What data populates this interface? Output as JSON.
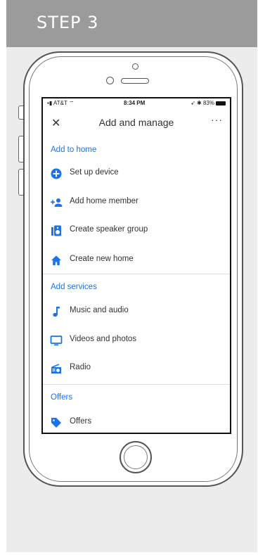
{
  "header": {
    "step_label": "STEP 3"
  },
  "status_bar": {
    "carrier": "AT&T",
    "time": "8:34 PM",
    "battery": "83%"
  },
  "app_bar": {
    "title": "Add and manage",
    "close_icon": "close-icon",
    "more_icon": "more-icon"
  },
  "sections": [
    {
      "header": "Add to home",
      "items": [
        {
          "label": "Set up device",
          "icon": "add-circle-icon"
        },
        {
          "label": "Add home member",
          "icon": "add-person-icon"
        },
        {
          "label": "Create speaker group",
          "icon": "speaker-group-icon"
        },
        {
          "label": "Create new home",
          "icon": "home-icon"
        }
      ]
    },
    {
      "header": "Add services",
      "items": [
        {
          "label": "Music and audio",
          "icon": "music-note-icon"
        },
        {
          "label": "Videos and photos",
          "icon": "tv-icon"
        },
        {
          "label": "Radio",
          "icon": "radio-icon"
        }
      ]
    },
    {
      "header": "Offers",
      "items": [
        {
          "label": "Offers",
          "icon": "tag-icon"
        }
      ]
    }
  ],
  "colors": {
    "accent": "#1a73e8",
    "header_bg": "#9b9b9b",
    "panel_bg": "#ececec"
  }
}
